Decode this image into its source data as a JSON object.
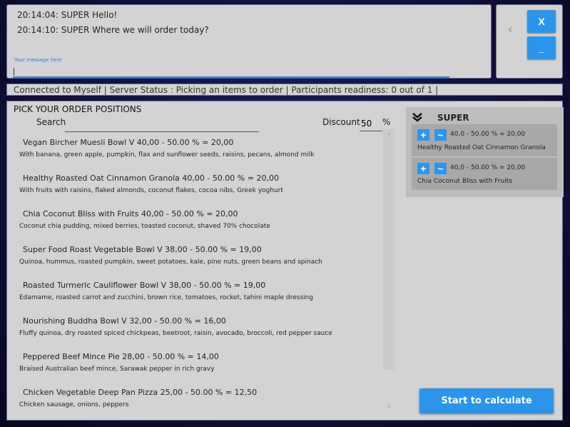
{
  "chat": {
    "messages": [
      "20:14:04: SUPER Hello!",
      "20:14:10: SUPER Where we will order today?"
    ],
    "input_hint": "Your message here",
    "input_value": ""
  },
  "side": {
    "back_icon": "chevron-left-icon",
    "close_label": "X",
    "minimize_label": "_"
  },
  "status_bar": "Connected to Myself | Server Status : Picking an items to order | Participants readiness: 0 out of 1 |",
  "main": {
    "title": "PICK YOUR ORDER POSITIONS",
    "search_label": "Search",
    "search_value": "",
    "discount_label": "Discount",
    "discount_value": "50",
    "discount_unit": "%",
    "menu": [
      {
        "name": "Vegan Bircher Muesli Bowl V  40,00 - 50.00 % = 20,00",
        "desc": "With banana, green apple, pumpkin, flax and sunflower seeds, raisins, pecans, almond milk"
      },
      {
        "name": "Healthy Roasted Oat Cinnamon Granola  40,00 - 50.00 % = 20,00",
        "desc": "With fruits with raisins, flaked almonds, coconut flakes, cocoa nibs, Greek yoghurt"
      },
      {
        "name": "Chia Coconut Bliss with Fruits  40,00 - 50.00 % = 20,00",
        "desc": "Coconut chia pudding, mixed berries, toasted coconut, shaved 70% chocolate"
      },
      {
        "name": "Super Food Roast Vegetable Bowl V  38,00 - 50.00 % = 19,00",
        "desc": "Quinoa, hummus, roasted pumpkin, sweet potatoes, kale, pine nuts, green beans and spinach"
      },
      {
        "name": "Roasted Turmeric Cauliflower Bowl V  38,00 - 50.00 % = 19,00",
        "desc": "Edamame, roasted carrot and zucchini, brown rice, tomatoes, rocket, tahini maple dressing"
      },
      {
        "name": "Nourishing Buddha Bowl V  32,00 - 50.00 % = 16,00",
        "desc": "Fluffy quinoa, dry roasted spiced chickpeas, beetroot, raisin, avocado, broccoli, red pepper sauce"
      },
      {
        "name": "Peppered Beef Mince Pie  28,00 - 50.00 % = 14,00",
        "desc": "Braised Australian beef mince, Sarawak pepper in rich gravy"
      },
      {
        "name": "Chicken Vegetable Deep Pan Pizza  25,00 - 50.00 % = 12,50",
        "desc": "Chicken sausage, onions, peppers"
      }
    ]
  },
  "order": {
    "user_icon": "double-chevron-down-icon",
    "user_name": "SUPER",
    "items": [
      {
        "calc": "40,0 - 50.00 % = 20,00",
        "name": "Healthy Roasted Oat Cinnamon Granola",
        "plus_label": "+",
        "minus_label": "~"
      },
      {
        "calc": "40,0 - 50.00 % = 20,00",
        "name": "Chia Coconut Bliss with Fruits",
        "plus_label": "+",
        "minus_label": "~"
      }
    ]
  },
  "calculate_label": "Start to calculate",
  "colors": {
    "accent": "#2b95ec",
    "panel": "#d3d3d3",
    "background": "#10103a"
  }
}
